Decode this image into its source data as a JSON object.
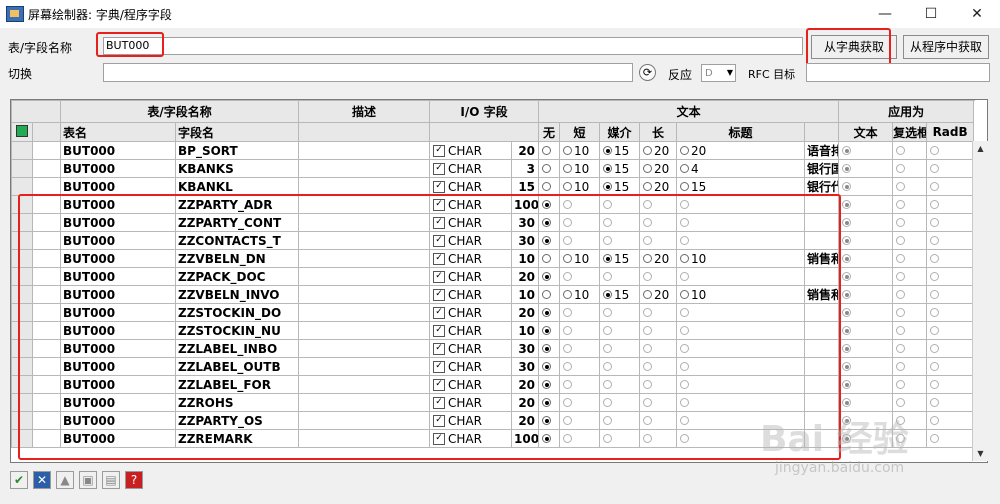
{
  "window": {
    "title": "屏幕绘制器: 字典/程序字段",
    "minimize": "—",
    "maximize": "☐",
    "close": "✕"
  },
  "form": {
    "table_field_label": "表/字段名称",
    "table_field_value": "BUT000",
    "switch_label": "切换",
    "switch_value": "",
    "reverse_label": "反应",
    "reverse_value": "D",
    "rfc_label": "RFC 目标",
    "rfc_value": "",
    "get_from_dict": "从字典获取",
    "get_from_program": "从程序中获取"
  },
  "table": {
    "group_headers": {
      "table_field": "表/字段名称",
      "description": "描述",
      "io_field": "I/O 字段",
      "text": "文本",
      "apply_as": "应用为"
    },
    "sub_headers": {
      "table_name": "表名",
      "field_name": "字段名",
      "none": "无",
      "short": "短",
      "medium": "媒介",
      "long": "长",
      "heading": "标题",
      "text": "文本",
      "checkbox": "复选框",
      "radio": "RadB"
    },
    "rows": [
      {
        "table": "BUT000",
        "field": "BP_SORT",
        "type": "CHAR",
        "len": "20",
        "none_sel": false,
        "n_short": "10",
        "n_med": "15",
        "n_long": "20",
        "n_head": "20",
        "sel": "med",
        "label": "语音排序字段",
        "show_nums": true
      },
      {
        "table": "BUT000",
        "field": "KBANKS",
        "type": "CHAR",
        "len": "3",
        "none_sel": false,
        "n_short": "10",
        "n_med": "15",
        "n_long": "20",
        "n_head": "4",
        "sel": "med",
        "label": "银行国家",
        "show_nums": true
      },
      {
        "table": "BUT000",
        "field": "KBANKL",
        "type": "CHAR",
        "len": "15",
        "none_sel": false,
        "n_short": "10",
        "n_med": "15",
        "n_long": "20",
        "n_head": "15",
        "sel": "med",
        "label": "银行代码",
        "show_nums": true
      },
      {
        "table": "BUT000",
        "field": "ZZPARTY_ADR",
        "type": "CHAR",
        "len": "100",
        "sel": "none",
        "label": "",
        "show_nums": false
      },
      {
        "table": "BUT000",
        "field": "ZZPARTY_CONT",
        "type": "CHAR",
        "len": "30",
        "sel": "none",
        "label": "",
        "show_nums": false
      },
      {
        "table": "BUT000",
        "field": "ZZCONTACTS_T",
        "type": "CHAR",
        "len": "30",
        "sel": "none",
        "label": "",
        "show_nums": false
      },
      {
        "table": "BUT000",
        "field": "ZZVBELN_DN",
        "type": "CHAR",
        "len": "10",
        "n_short": "10",
        "n_med": "15",
        "n_long": "20",
        "n_head": "10",
        "sel": "med",
        "label": "销售和分销凭证",
        "show_nums": true
      },
      {
        "table": "BUT000",
        "field": "ZZPACK_DOC",
        "type": "CHAR",
        "len": "20",
        "sel": "none",
        "label": "",
        "show_nums": false
      },
      {
        "table": "BUT000",
        "field": "ZZVBELN_INVO",
        "type": "CHAR",
        "len": "10",
        "n_short": "10",
        "n_med": "15",
        "n_long": "20",
        "n_head": "10",
        "sel": "med",
        "label": "销售和分销凭证",
        "show_nums": true
      },
      {
        "table": "BUT000",
        "field": "ZZSTOCKIN_DO",
        "type": "CHAR",
        "len": "20",
        "sel": "none",
        "label": "",
        "show_nums": false
      },
      {
        "table": "BUT000",
        "field": "ZZSTOCKIN_NU",
        "type": "CHAR",
        "len": "10",
        "sel": "none",
        "label": "",
        "show_nums": false
      },
      {
        "table": "BUT000",
        "field": "ZZLABEL_INBO",
        "type": "CHAR",
        "len": "30",
        "sel": "none",
        "label": "",
        "show_nums": false
      },
      {
        "table": "BUT000",
        "field": "ZZLABEL_OUTB",
        "type": "CHAR",
        "len": "30",
        "sel": "none",
        "label": "",
        "show_nums": false
      },
      {
        "table": "BUT000",
        "field": "ZZLABEL_FOR",
        "type": "CHAR",
        "len": "20",
        "sel": "none",
        "label": "",
        "show_nums": false
      },
      {
        "table": "BUT000",
        "field": "ZZROHS",
        "type": "CHAR",
        "len": "20",
        "sel": "none",
        "label": "",
        "show_nums": false
      },
      {
        "table": "BUT000",
        "field": "ZZPARTY_OS",
        "type": "CHAR",
        "len": "20",
        "sel": "none",
        "label": "",
        "show_nums": false
      },
      {
        "table": "BUT000",
        "field": "ZZREMARK",
        "type": "CHAR",
        "len": "100",
        "sel": "none",
        "label": "",
        "show_nums": false
      }
    ]
  },
  "watermark": {
    "main": "Bai 经验",
    "sub": "jingyan.baidu.com"
  },
  "colors": {
    "highlight": "#e8201c",
    "grid_header": "#e8e8e8"
  }
}
